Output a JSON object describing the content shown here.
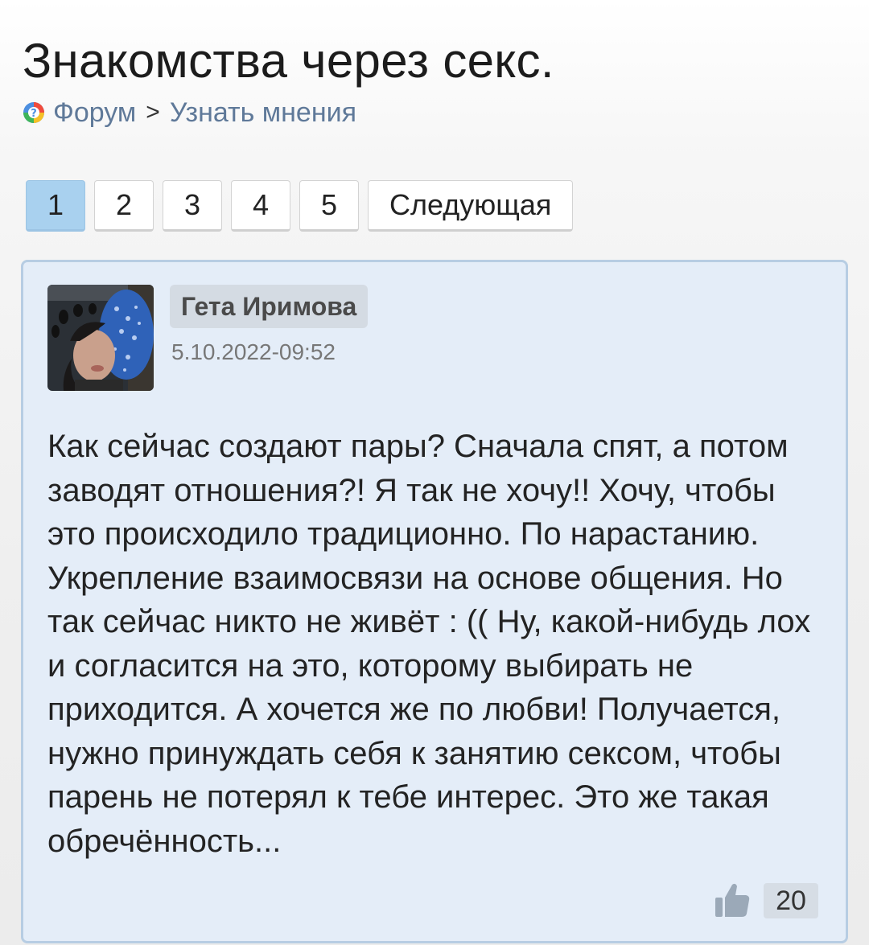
{
  "page": {
    "title": "Знакомства через секс."
  },
  "breadcrumb": {
    "forum_label": "Форум",
    "separator": ">",
    "section_label": "Узнать мнения"
  },
  "pagination": {
    "pages": [
      "1",
      "2",
      "3",
      "4",
      "5"
    ],
    "current_page": "1",
    "next_label": "Следующая"
  },
  "post": {
    "author": "Гета Иримова",
    "date": "5.10.2022-09:52",
    "text": "Как сейчас создают пары? Сначала спят, а потом заводят отношения?! Я так не хочу!! Хочу, чтобы это происходило традиционно. По нарастанию. Укрепление взаимосвязи на основе общения. Но так сейчас никто не живёт : (( Ну, какой-нибудь лох и согласится на это, которому выбирать не приходится. А хочется же по любви! Получается, нужно принуждать себя к занятию сексом, чтобы парень не потерял к тебе интерес. Это же такая обречённость...",
    "likes": "20"
  },
  "colors": {
    "accent_active_page": "#a9d1ef",
    "post_background": "#e4edf8",
    "post_border": "#b7cde3",
    "link": "#5f7999"
  },
  "icons": {
    "forum": "forum-logo-icon",
    "like": "thumbs-up-icon"
  }
}
